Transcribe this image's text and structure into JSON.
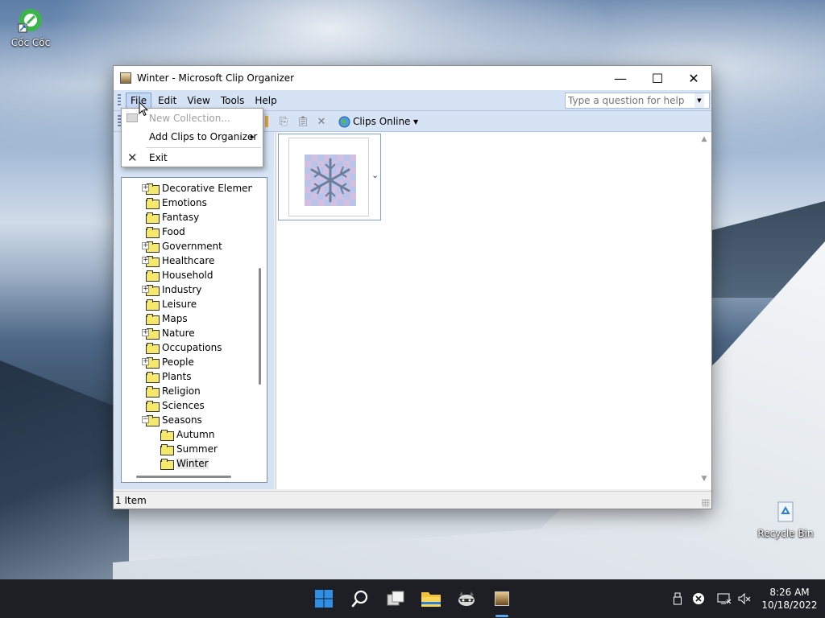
{
  "desktop": {
    "icons": [
      {
        "label": "Cốc Cốc"
      },
      {
        "label": "Recycle Bin"
      }
    ]
  },
  "window": {
    "title": "Winter - Microsoft Clip Organizer",
    "controls": {
      "minimize": "—",
      "maximize": "☐",
      "close": "✕"
    }
  },
  "menubar": {
    "items": [
      "File",
      "Edit",
      "View",
      "Tools",
      "Help"
    ],
    "help_placeholder": "Type a question for help"
  },
  "toolbar": {
    "clips_online": "Clips Online"
  },
  "file_menu": {
    "items": [
      {
        "label": "New Collection...",
        "enabled": false
      },
      {
        "label": "Add Clips to Organizer",
        "enabled": true,
        "submenu_arrow": "▸"
      },
      {
        "label": "Exit",
        "enabled": true
      }
    ]
  },
  "tree": {
    "items": [
      {
        "label": "Decorative Element",
        "expandable": true
      },
      {
        "label": "Emotions",
        "expandable": false
      },
      {
        "label": "Fantasy",
        "expandable": false
      },
      {
        "label": "Food",
        "expandable": false
      },
      {
        "label": "Government",
        "expandable": true
      },
      {
        "label": "Healthcare",
        "expandable": true
      },
      {
        "label": "Household",
        "expandable": false
      },
      {
        "label": "Industry",
        "expandable": true
      },
      {
        "label": "Leisure",
        "expandable": false
      },
      {
        "label": "Maps",
        "expandable": false
      },
      {
        "label": "Nature",
        "expandable": true
      },
      {
        "label": "Occupations",
        "expandable": false
      },
      {
        "label": "People",
        "expandable": true
      },
      {
        "label": "Plants",
        "expandable": false
      },
      {
        "label": "Religion",
        "expandable": false
      },
      {
        "label": "Sciences",
        "expandable": false
      },
      {
        "label": "Seasons",
        "expandable": true,
        "expanded": true
      },
      {
        "label": "Autumn",
        "child": true
      },
      {
        "label": "Summer",
        "child": true
      },
      {
        "label": "Winter",
        "child": true,
        "selected": true
      }
    ]
  },
  "status": {
    "count": "1 Item"
  },
  "taskbar": {
    "time": "8:26 AM",
    "date": "10/18/2022"
  },
  "colors": {
    "menubar_bg": "#d6e3f5",
    "taskbar_bg": "#1e1f24",
    "folder_yellow": "#f5e86a"
  }
}
